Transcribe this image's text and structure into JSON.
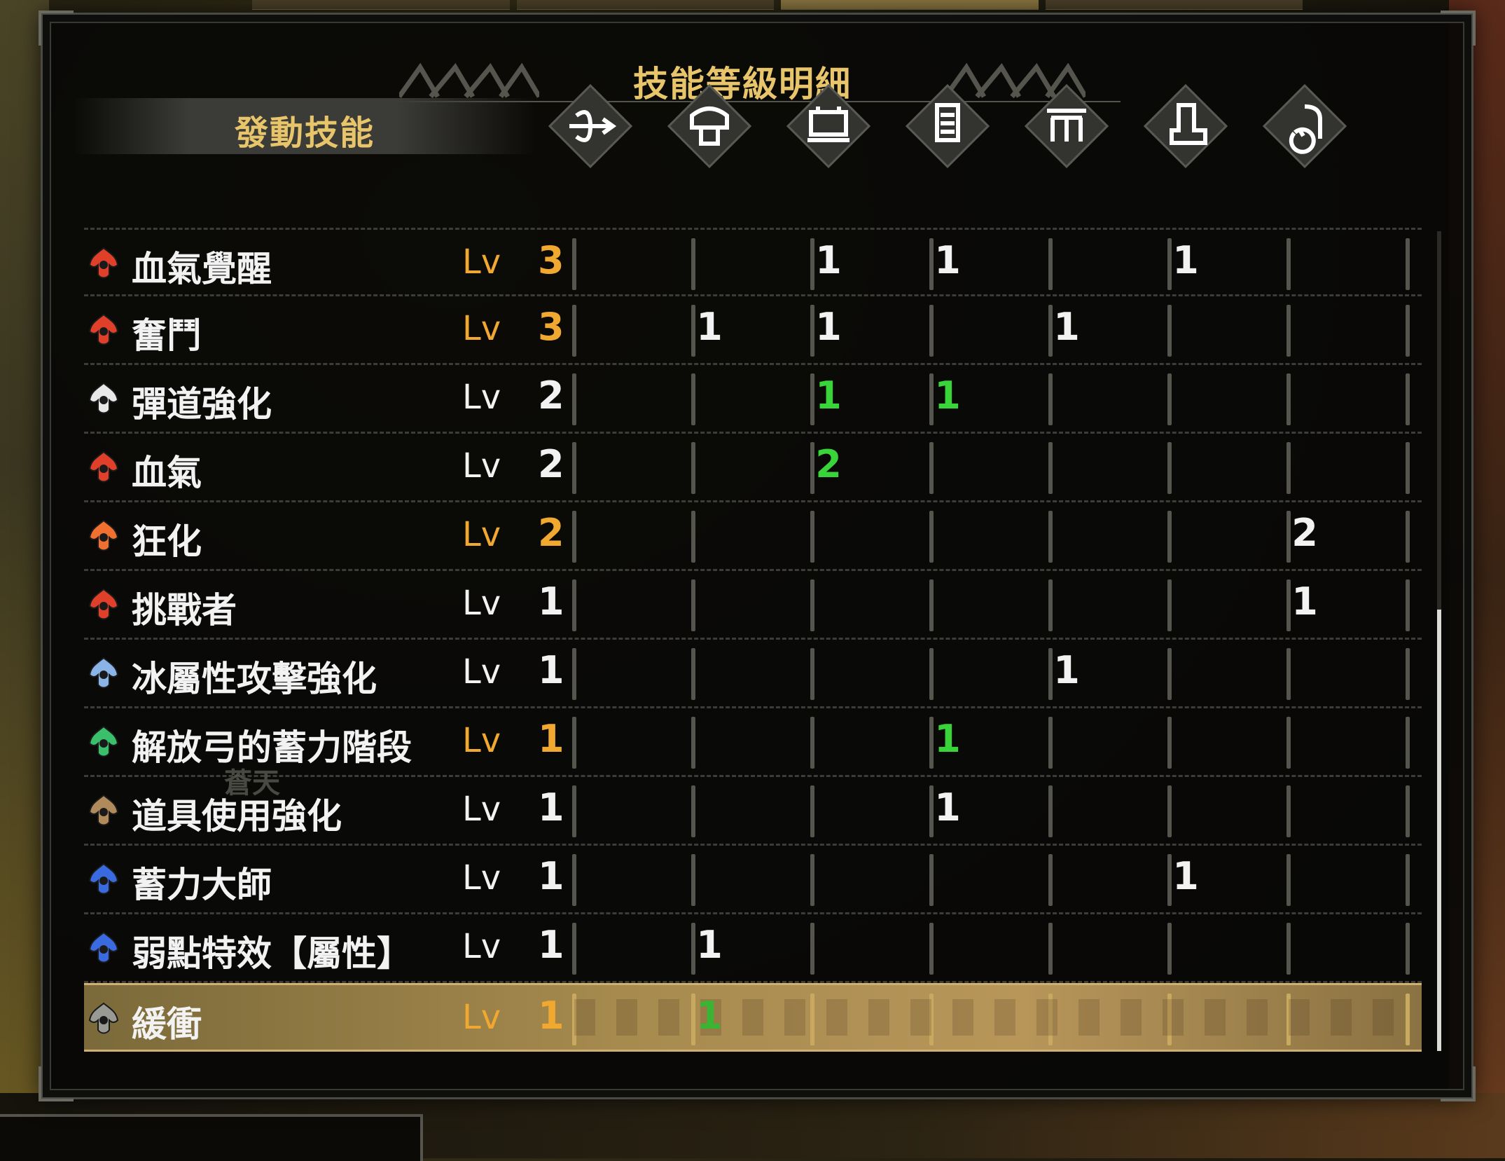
{
  "window": {
    "title": "技能等級明細",
    "column_header": "發動技能",
    "sub_note": "蒼天"
  },
  "colors": {
    "gold": "#e8c56a",
    "max_level_orange": "#f0a830",
    "green_decoration": "#38d43a",
    "white": "#f2f2f2"
  },
  "equipment_columns": [
    {
      "icon": "bow-weapon-icon"
    },
    {
      "icon": "helmet-icon"
    },
    {
      "icon": "chest-armor-icon"
    },
    {
      "icon": "gauntlet-icon"
    },
    {
      "icon": "waist-armor-icon"
    },
    {
      "icon": "greaves-icon"
    },
    {
      "icon": "talisman-icon"
    }
  ],
  "skills": [
    {
      "name": "血氣覺醒",
      "lv_label": "Lv",
      "level": "3",
      "max": true,
      "icon_color": "#e0402a",
      "cells": [
        "",
        "",
        "1",
        "1",
        "",
        "1",
        ""
      ],
      "green": [
        false,
        false,
        false,
        false,
        false,
        false,
        false
      ]
    },
    {
      "name": "奮鬥",
      "lv_label": "Lv",
      "level": "3",
      "max": true,
      "icon_color": "#e0402a",
      "cells": [
        "",
        "1",
        "1",
        "",
        "1",
        "",
        ""
      ],
      "green": [
        false,
        false,
        false,
        false,
        false,
        false,
        false
      ]
    },
    {
      "name": "彈道強化",
      "lv_label": "Lv",
      "level": "2",
      "max": false,
      "icon_color": "#e8e8e8",
      "cells": [
        "",
        "",
        "1",
        "1",
        "",
        "",
        ""
      ],
      "green": [
        false,
        false,
        true,
        true,
        false,
        false,
        false
      ]
    },
    {
      "name": "血氣",
      "lv_label": "Lv",
      "level": "2",
      "max": false,
      "icon_color": "#e0402a",
      "cells": [
        "",
        "",
        "2",
        "",
        "",
        "",
        ""
      ],
      "green": [
        false,
        false,
        true,
        false,
        false,
        false,
        false
      ]
    },
    {
      "name": "狂化",
      "lv_label": "Lv",
      "level": "2",
      "max": true,
      "icon_color": "#f07030",
      "cells": [
        "",
        "",
        "",
        "",
        "",
        "",
        "2"
      ],
      "green": [
        false,
        false,
        false,
        false,
        false,
        false,
        false
      ]
    },
    {
      "name": "挑戰者",
      "lv_label": "Lv",
      "level": "1",
      "max": false,
      "icon_color": "#e0402a",
      "cells": [
        "",
        "",
        "",
        "",
        "",
        "",
        "1"
      ],
      "green": [
        false,
        false,
        false,
        false,
        false,
        false,
        false
      ]
    },
    {
      "name": "冰屬性攻擊強化",
      "lv_label": "Lv",
      "level": "1",
      "max": false,
      "icon_color": "#8ab4e8",
      "cells": [
        "",
        "",
        "",
        "",
        "1",
        "",
        ""
      ],
      "green": [
        false,
        false,
        false,
        false,
        false,
        false,
        false
      ]
    },
    {
      "name": "解放弓的蓄力階段",
      "lv_label": "Lv",
      "level": "1",
      "max": true,
      "icon_color": "#3ac06a",
      "cells": [
        "",
        "",
        "",
        "1",
        "",
        "",
        ""
      ],
      "green": [
        false,
        false,
        false,
        true,
        false,
        false,
        false
      ]
    },
    {
      "name": "道具使用強化",
      "lv_label": "Lv",
      "level": "1",
      "max": false,
      "icon_color": "#b08a5a",
      "cells": [
        "",
        "",
        "",
        "1",
        "",
        "",
        ""
      ],
      "green": [
        false,
        false,
        false,
        false,
        false,
        false,
        false
      ]
    },
    {
      "name": "蓄力大師",
      "lv_label": "Lv",
      "level": "1",
      "max": false,
      "icon_color": "#3a6ae0",
      "cells": [
        "",
        "",
        "",
        "",
        "",
        "1",
        ""
      ],
      "green": [
        false,
        false,
        false,
        false,
        false,
        false,
        false
      ]
    },
    {
      "name": "弱點特效【屬性】",
      "lv_label": "Lv",
      "level": "1",
      "max": false,
      "icon_color": "#3a6ae0",
      "cells": [
        "",
        "1",
        "",
        "",
        "",
        "",
        ""
      ],
      "green": [
        false,
        false,
        false,
        false,
        false,
        false,
        false
      ]
    },
    {
      "name": "緩衝",
      "lv_label": "Lv",
      "level": "1",
      "max": true,
      "icon_color": "#9a9a94",
      "cells": [
        "",
        "1",
        "",
        "",
        "",
        "",
        ""
      ],
      "green": [
        false,
        true,
        false,
        false,
        false,
        false,
        false
      ],
      "selected": true
    }
  ]
}
